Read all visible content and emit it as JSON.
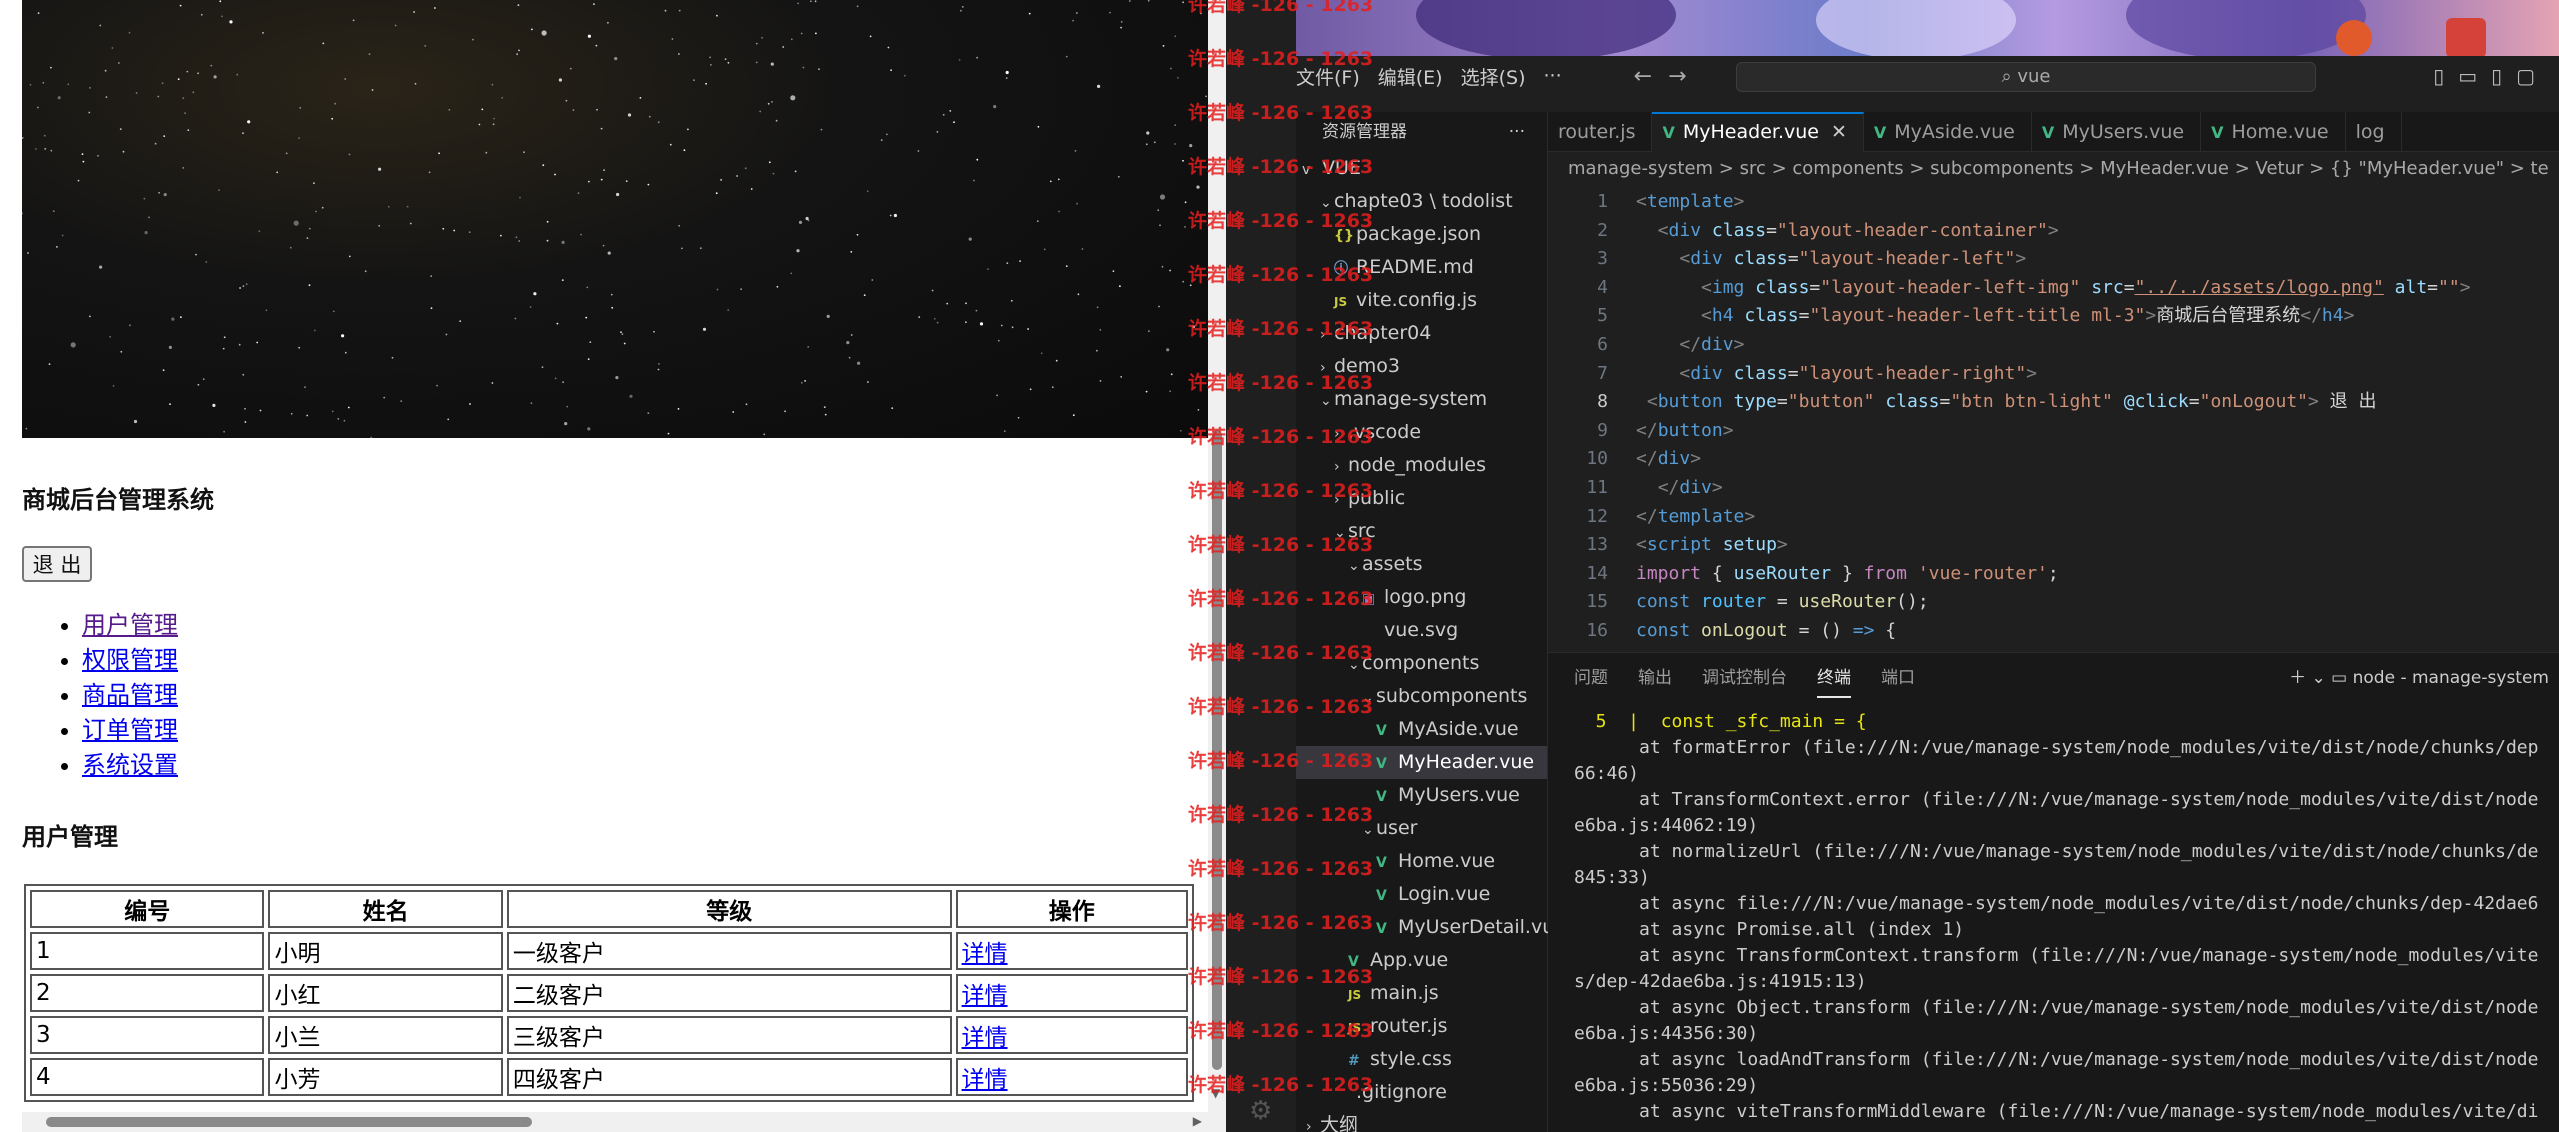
{
  "browser": {
    "site_title": "商城后台管理系统",
    "logout_label": "退 出",
    "menu": [
      "用户管理",
      "权限管理",
      "商品管理",
      "订单管理",
      "系统设置"
    ],
    "section_title": "用户管理",
    "table": {
      "headers": [
        "编号",
        "姓名",
        "等级",
        "操作"
      ],
      "rows": [
        [
          "1",
          "小明",
          "一级客户",
          "详情"
        ],
        [
          "2",
          "小红",
          "二级客户",
          "详情"
        ],
        [
          "3",
          "小兰",
          "三级客户",
          "详情"
        ],
        [
          "4",
          "小芳",
          "四级客户",
          "详情"
        ]
      ]
    }
  },
  "watermark": {
    "text": "许若峰 -126 - 1263",
    "color": "#e61e1e"
  },
  "vscode": {
    "menu": [
      "文件(F)",
      "编辑(E)",
      "选择(S)",
      "···"
    ],
    "search_text": "vue",
    "explorer": {
      "title": "资源管理器",
      "dots": "···",
      "root": "VUE",
      "items": [
        {
          "label": "chapte03 \\ todolist",
          "icon": "",
          "chev": "v",
          "indent": 1
        },
        {
          "label": "package.json",
          "icon": "{}",
          "icls": "ic-json",
          "chev": "",
          "indent": 2
        },
        {
          "label": "README.md",
          "icon": "ⓘ",
          "icls": "ic-info",
          "chev": "",
          "indent": 2
        },
        {
          "label": "vite.config.js",
          "icon": "JS",
          "icls": "ic-js",
          "chev": "",
          "indent": 2
        },
        {
          "label": "chapter04",
          "icon": "",
          "chev": ">",
          "indent": 1
        },
        {
          "label": "demo3",
          "icon": "",
          "chev": ">",
          "indent": 1
        },
        {
          "label": "manage-system",
          "icon": "",
          "chev": "v",
          "indent": 1
        },
        {
          "label": ".vscode",
          "icon": "",
          "chev": ">",
          "indent": 2
        },
        {
          "label": "node_modules",
          "icon": "",
          "chev": ">",
          "indent": 2
        },
        {
          "label": "public",
          "icon": "",
          "chev": ">",
          "indent": 2
        },
        {
          "label": "src",
          "icon": "",
          "chev": "v",
          "indent": 2
        },
        {
          "label": "assets",
          "icon": "",
          "chev": "v",
          "indent": 3
        },
        {
          "label": "logo.png",
          "icon": "▣",
          "icls": "ic-img",
          "chev": "",
          "indent": 4
        },
        {
          "label": "vue.svg",
          "icon": "",
          "chev": "",
          "indent": 4
        },
        {
          "label": "components",
          "icon": "",
          "chev": "v",
          "indent": 3
        },
        {
          "label": "subcomponents",
          "icon": "",
          "chev": "v",
          "indent": 4
        },
        {
          "label": "MyAside.vue",
          "icon": "V",
          "icls": "ic-vue",
          "chev": "",
          "indent": 5
        },
        {
          "label": "MyHeader.vue",
          "icon": "V",
          "icls": "ic-vue",
          "chev": "",
          "indent": 5,
          "selected": true
        },
        {
          "label": "MyUsers.vue",
          "icon": "V",
          "icls": "ic-vue",
          "chev": "",
          "indent": 5
        },
        {
          "label": "user",
          "icon": "",
          "chev": "v",
          "indent": 4
        },
        {
          "label": "Home.vue",
          "icon": "V",
          "icls": "ic-vue",
          "chev": "",
          "indent": 5
        },
        {
          "label": "Login.vue",
          "icon": "V",
          "icls": "ic-vue",
          "chev": "",
          "indent": 5
        },
        {
          "label": "MyUserDetail.vue",
          "icon": "V",
          "icls": "ic-vue",
          "chev": "",
          "indent": 5
        },
        {
          "label": "App.vue",
          "icon": "V",
          "icls": "ic-vue",
          "chev": "",
          "indent": 3
        },
        {
          "label": "main.js",
          "icon": "JS",
          "icls": "ic-js",
          "chev": "",
          "indent": 3
        },
        {
          "label": "router.js",
          "icon": "JS",
          "icls": "ic-js",
          "chev": "",
          "indent": 3
        },
        {
          "label": "style.css",
          "icon": "#",
          "icls": "ic-css",
          "chev": "",
          "indent": 3
        },
        {
          "label": ".gitignore",
          "icon": "",
          "chev": "",
          "indent": 2
        },
        {
          "label": "大纲",
          "icon": "",
          "chev": ">",
          "indent": 0
        }
      ]
    },
    "tabs": [
      {
        "label": "router.js",
        "vue": false,
        "active": false
      },
      {
        "label": "MyHeader.vue",
        "vue": true,
        "active": true
      },
      {
        "label": "MyAside.vue",
        "vue": true,
        "active": false
      },
      {
        "label": "MyUsers.vue",
        "vue": true,
        "active": false
      },
      {
        "label": "Home.vue",
        "vue": true,
        "active": false
      },
      {
        "label": "log",
        "vue": false,
        "active": false
      }
    ],
    "breadcrumb": "manage-system  >  src  >  components  >  subcomponents  >  MyHeader.vue  >  Vetur  >  {} \"MyHeader.vue\"  >  te",
    "code_lines": [
      {
        "n": "1",
        "html": "<span class='c-gray'>&lt;</span><span class='c-tag'>template</span><span class='c-gray'>&gt;</span>"
      },
      {
        "n": "2",
        "html": "  <span class='c-gray'>&lt;</span><span class='c-tag'>div</span> <span class='c-attr'>class</span><span class='c-txt'>=</span><span class='c-str'>\"layout-header-container\"</span><span class='c-gray'>&gt;</span>"
      },
      {
        "n": "3",
        "html": "    <span class='c-gray'>&lt;</span><span class='c-tag'>div</span> <span class='c-attr'>class</span><span class='c-txt'>=</span><span class='c-str'>\"layout-header-left\"</span><span class='c-gray'>&gt;</span>"
      },
      {
        "n": "4",
        "html": "      <span class='c-gray'>&lt;</span><span class='c-tag'>img</span> <span class='c-attr'>class</span><span class='c-txt'>=</span><span class='c-str'>\"layout-header-left-img\"</span> <span class='c-attr'>src</span><span class='c-txt'>=</span><span class='c-str' style='text-decoration:underline'>\"../../assets/logo.png\"</span> <span class='c-attr'>alt</span><span class='c-txt'>=</span><span class='c-str'>\"\"</span><span class='c-gray'>&gt;</span>"
      },
      {
        "n": "5",
        "html": "      <span class='c-gray'>&lt;</span><span class='c-tag'>h4</span> <span class='c-attr'>class</span><span class='c-txt'>=</span><span class='c-str'>\"layout-header-left-title ml-3\"</span><span class='c-gray'>&gt;</span><span class='c-txt'>商城后台管理系统</span><span class='c-gray'>&lt;/</span><span class='c-tag'>h4</span><span class='c-gray'>&gt;</span>"
      },
      {
        "n": "6",
        "html": "    <span class='c-gray'>&lt;/</span><span class='c-tag'>div</span><span class='c-gray'>&gt;</span>"
      },
      {
        "n": "7",
        "html": "    <span class='c-gray'>&lt;</span><span class='c-tag'>div</span> <span class='c-attr'>class</span><span class='c-txt'>=</span><span class='c-str'>\"layout-header-right\"</span><span class='c-gray'>&gt;</span>"
      },
      {
        "n": "8",
        "cur": true,
        "html": " <span class='c-gray'>&lt;</span><span class='c-tag'>button</span> <span class='c-attr'>type</span><span class='c-txt'>=</span><span class='c-str'>\"button\"</span> <span class='c-attr'>class</span><span class='c-txt'>=</span><span class='c-str'>\"btn btn-light\"</span> <span class='c-attr'>@click</span><span class='c-txt'>=</span><span class='c-str'>\"onLogout\"</span><span class='c-gray'>&gt;</span><span class='c-txt'> 退 出</span>"
      },
      {
        "n": "9",
        "html": "<span class='c-gray'>&lt;/</span><span class='c-tag'>button</span><span class='c-gray'>&gt;</span>"
      },
      {
        "n": "10",
        "html": "<span class='c-gray'>&lt;/</span><span class='c-tag'>div</span><span class='c-gray'>&gt;</span>"
      },
      {
        "n": "11",
        "html": "  <span class='c-gray'>&lt;/</span><span class='c-tag'>div</span><span class='c-gray'>&gt;</span>"
      },
      {
        "n": "12",
        "html": "<span class='c-gray'>&lt;/</span><span class='c-tag'>template</span><span class='c-gray'>&gt;</span>"
      },
      {
        "n": "13",
        "html": "<span class='c-gray'>&lt;</span><span class='c-tag'>script</span> <span class='c-attr'>setup</span><span class='c-gray'>&gt;</span>"
      },
      {
        "n": "14",
        "html": "<span class='c-kw'>import</span> <span class='c-txt'>{ </span><span class='c-attr'>useRouter</span><span class='c-txt'> } </span><span class='c-kw'>from</span> <span class='c-str'>'vue-router'</span><span class='c-txt'>;</span>"
      },
      {
        "n": "15",
        "html": "<span class='c-kw2'>const</span> <span class='c-var'>router</span> <span class='c-txt'>= </span><span class='c-fn'>useRouter</span><span class='c-txt'>();</span>"
      },
      {
        "n": "16",
        "html": "<span class='c-kw2'>const</span> <span class='c-fn'>onLogout</span> <span class='c-txt'>= () </span><span class='c-kw2'>=&gt;</span><span class='c-txt'> {</span>"
      }
    ],
    "panel": {
      "tabs": [
        "问题",
        "输出",
        "调试控制台",
        "终端",
        "端口"
      ],
      "active_tab": "终端",
      "terminal_name": "node - manage-system",
      "lines": [
        {
          "t": "  5  |  const _sfc_main = {",
          "yel": true
        },
        {
          "t": "      at formatError (file:///N:/vue/manage-system/node_modules/vite/dist/node/chunks/dep"
        },
        {
          "t": "66:46)"
        },
        {
          "t": "      at TransformContext.error (file:///N:/vue/manage-system/node_modules/vite/dist/node"
        },
        {
          "t": "e6ba.js:44062:19)"
        },
        {
          "t": "      at normalizeUrl (file:///N:/vue/manage-system/node_modules/vite/dist/node/chunks/de"
        },
        {
          "t": "845:33)"
        },
        {
          "t": "      at async file:///N:/vue/manage-system/node_modules/vite/dist/node/chunks/dep-42dae6"
        },
        {
          "t": "      at async Promise.all (index 1)"
        },
        {
          "t": "      at async TransformContext.transform (file:///N:/vue/manage-system/node_modules/vite"
        },
        {
          "t": "s/dep-42dae6ba.js:41915:13)"
        },
        {
          "t": "      at async Object.transform (file:///N:/vue/manage-system/node_modules/vite/dist/node"
        },
        {
          "t": "e6ba.js:44356:30)"
        },
        {
          "t": "      at async loadAndTransform (file:///N:/vue/manage-system/node_modules/vite/dist/node"
        },
        {
          "t": "e6ba.js:55036:29)"
        },
        {
          "t": "      at async viteTransformMiddleware (file:///N:/vue/manage-system/node_modules/vite/di"
        }
      ]
    }
  }
}
